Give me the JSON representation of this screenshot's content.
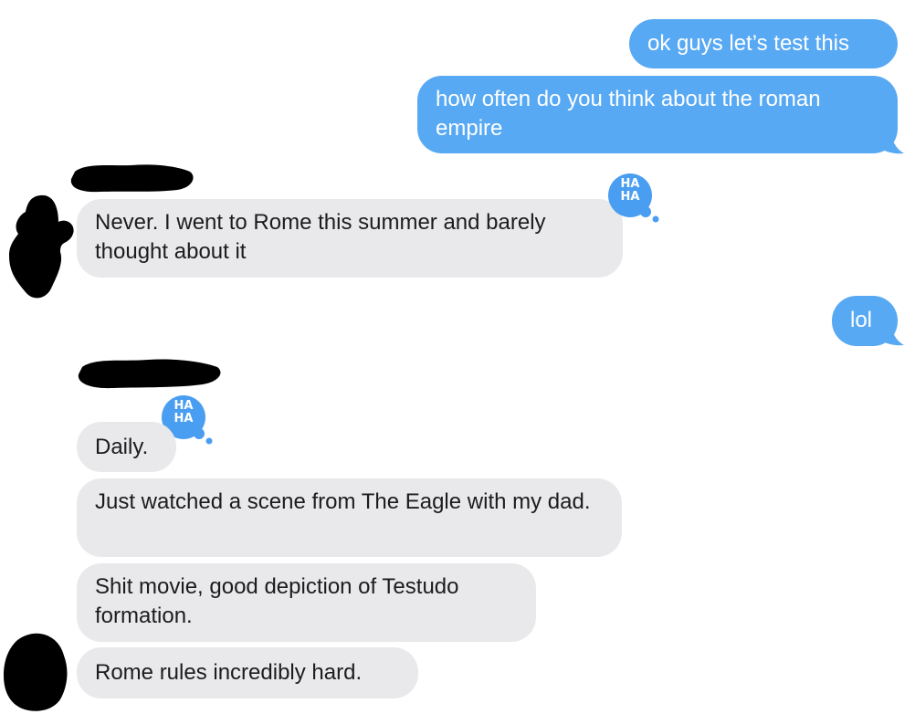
{
  "colors": {
    "sent_bubble": "#58a9f4",
    "received_bubble": "#e9e9eb",
    "received_text": "#1c1c1e",
    "tapback_blue": "#4a9ef1",
    "redaction": "#000000"
  },
  "messages": [
    {
      "direction": "outgoing",
      "text": "ok guys let’s test this"
    },
    {
      "direction": "outgoing",
      "text": "how often do you think about the roman empire"
    },
    {
      "direction": "incoming",
      "text": "Never. I went to Rome this summer and barely thought about it",
      "reaction": "HA HA"
    },
    {
      "direction": "outgoing",
      "text": "lol"
    },
    {
      "direction": "incoming",
      "text": "Daily.",
      "reaction": "HA HA"
    },
    {
      "direction": "incoming",
      "text": "Just watched a scene from The Eagle with my dad."
    },
    {
      "direction": "incoming",
      "text": "Shit movie, good depiction of Testudo formation."
    },
    {
      "direction": "incoming",
      "text": "Rome rules incredibly hard."
    }
  ],
  "tapback": {
    "line1": "HA",
    "line2": "HA",
    "icon": "haha-tapback-icon"
  }
}
